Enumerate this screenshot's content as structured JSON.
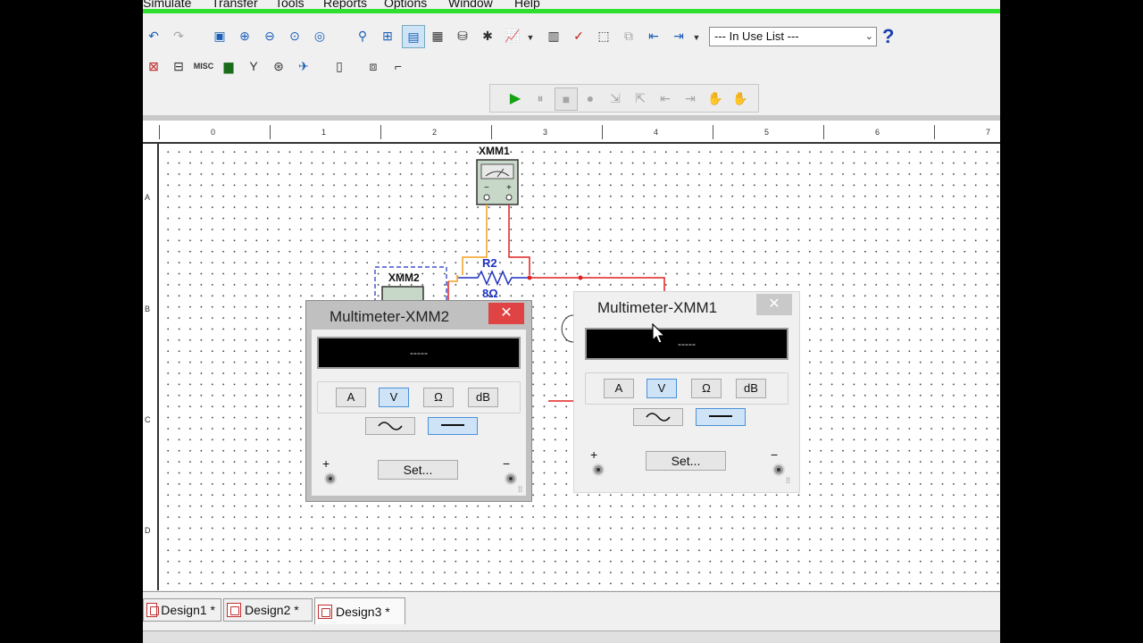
{
  "menu": [
    "Simulate",
    "Transfer",
    "Tools",
    "Reports",
    "Options",
    "Window",
    "Help"
  ],
  "toolbar": {
    "in_use_list": "--- In Use List ---",
    "help_glyph": "?",
    "misc_label": "MISC"
  },
  "ruler": {
    "h_ticks": [
      "0",
      "1",
      "2",
      "3",
      "4",
      "5",
      "6",
      "7"
    ],
    "v_ticks": [
      "A",
      "B",
      "C",
      "D"
    ]
  },
  "schematic": {
    "xmm1_label": "XMM1",
    "xmm2_label": "XMM2",
    "r2_label": "R2",
    "r2_value": "8Ω"
  },
  "multimeter_xmm2": {
    "title": "Multimeter-XMM2",
    "display": "-----",
    "modes": [
      "A",
      "V",
      "Ω",
      "dB"
    ],
    "selected_mode": "V",
    "selected_wave": "dc",
    "set_label": "Set...",
    "plus": "+",
    "minus": "−"
  },
  "multimeter_xmm1": {
    "title": "Multimeter-XMM1",
    "display": "-----",
    "modes": [
      "A",
      "V",
      "Ω",
      "dB"
    ],
    "selected_mode": "V",
    "selected_wave": "dc",
    "set_label": "Set...",
    "plus": "+",
    "minus": "−"
  },
  "tabs": [
    {
      "label": "Design1 *",
      "active": false
    },
    {
      "label": "Design2 *",
      "active": false
    },
    {
      "label": "Design3 *",
      "active": true
    }
  ],
  "colors": {
    "wire_red": "#e02020",
    "wire_orange": "#f0a020",
    "component_blue": "#1b2fc0",
    "accent_green": "#2ee02e"
  }
}
